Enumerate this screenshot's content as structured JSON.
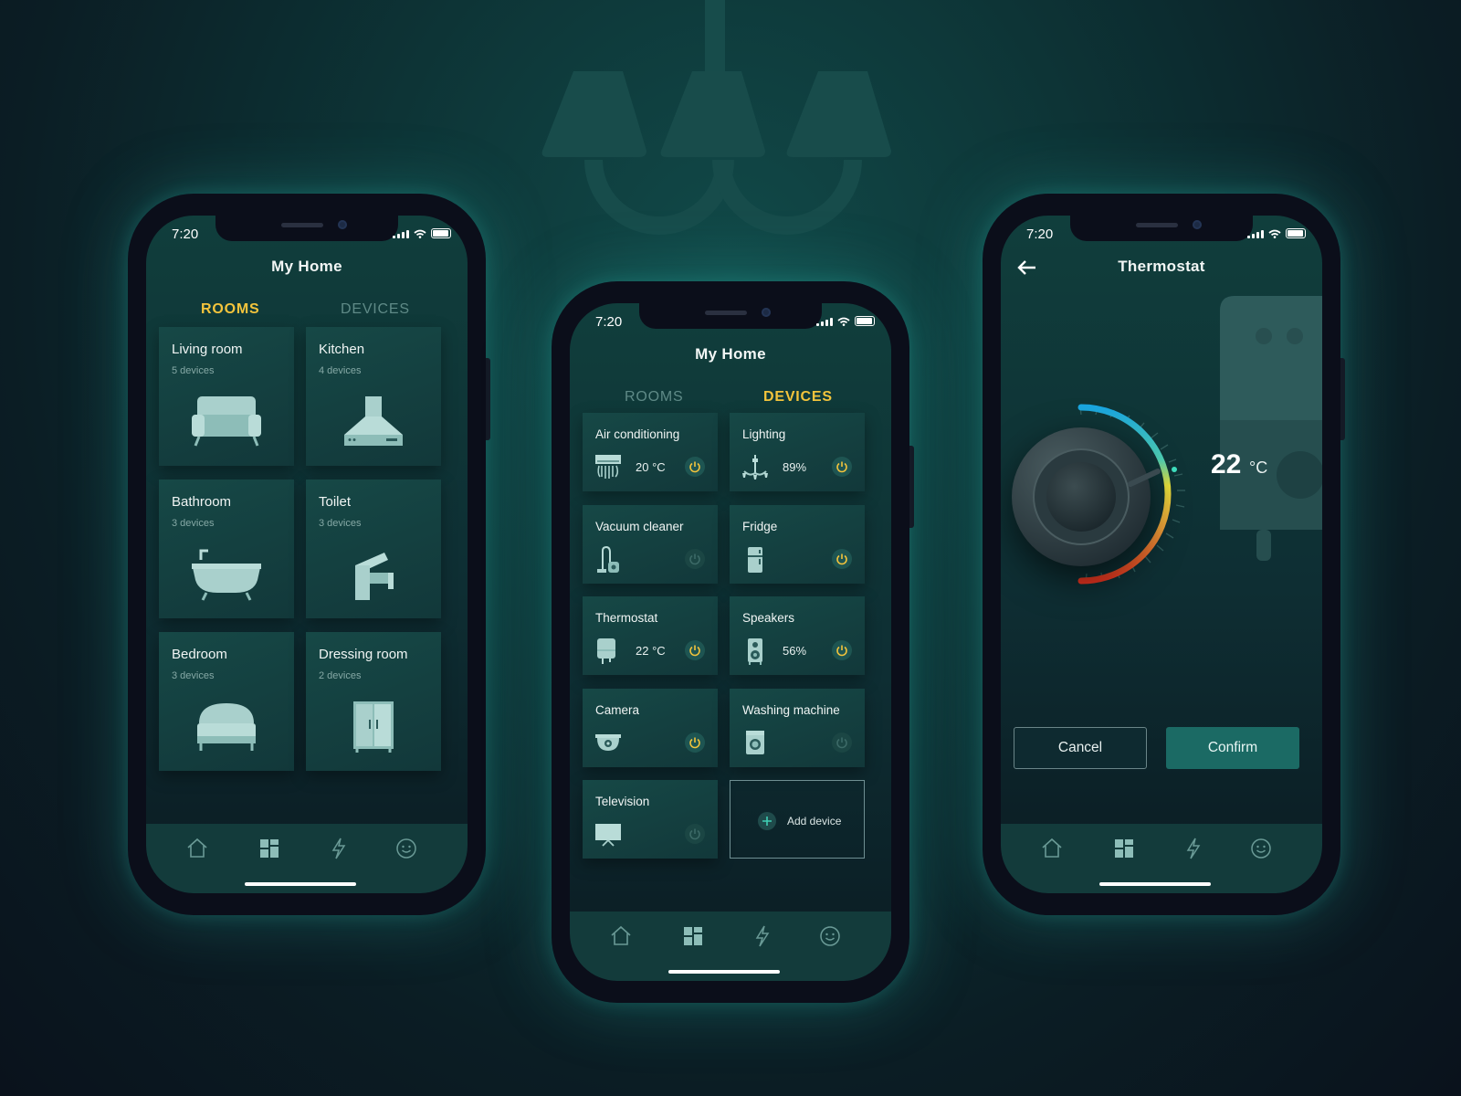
{
  "status_time": "7:20",
  "left_phone": {
    "title": "My Home",
    "tabs": [
      {
        "label": "ROOMS",
        "active": true
      },
      {
        "label": "DEVICES",
        "active": false
      }
    ],
    "rooms": [
      {
        "name": "Living room",
        "devices": "5 devices",
        "icon": "sofa-icon"
      },
      {
        "name": "Kitchen",
        "devices": "4 devices",
        "icon": "range-hood-icon"
      },
      {
        "name": "Bathroom",
        "devices": "3 devices",
        "icon": "bathtub-icon"
      },
      {
        "name": "Toilet",
        "devices": "3 devices",
        "icon": "faucet-icon"
      },
      {
        "name": "Bedroom",
        "devices": "3 devices",
        "icon": "bed-icon"
      },
      {
        "name": "Dressing room",
        "devices": "2 devices",
        "icon": "wardrobe-icon"
      }
    ]
  },
  "middle_phone": {
    "title": "My Home",
    "tabs": [
      {
        "label": "ROOMS",
        "active": false
      },
      {
        "label": "DEVICES",
        "active": true
      }
    ],
    "devices": [
      {
        "name": "Air conditioning",
        "value": "20 °C",
        "on": true,
        "icon": "air-conditioner-icon"
      },
      {
        "name": "Lighting",
        "value": "89%",
        "on": true,
        "icon": "chandelier-icon"
      },
      {
        "name": "Vacuum cleaner",
        "value": "",
        "on": false,
        "icon": "vacuum-cleaner-icon"
      },
      {
        "name": "Fridge",
        "value": "",
        "on": true,
        "icon": "fridge-icon"
      },
      {
        "name": "Thermostat",
        "value": "22 °C",
        "on": true,
        "icon": "water-heater-icon"
      },
      {
        "name": "Speakers",
        "value": "56%",
        "on": true,
        "icon": "speaker-icon"
      },
      {
        "name": "Camera",
        "value": "",
        "on": true,
        "icon": "camera-icon"
      },
      {
        "name": "Washing machine",
        "value": "",
        "on": false,
        "icon": "washing-machine-icon"
      },
      {
        "name": "Television",
        "value": "",
        "on": false,
        "icon": "television-icon"
      }
    ],
    "add_device_label": "Add device"
  },
  "right_phone": {
    "title": "Thermostat",
    "temperature": "22",
    "unit": "°C",
    "cancel_label": "Cancel",
    "confirm_label": "Confirm"
  },
  "nav_icons": [
    "home-icon",
    "dashboard-icon",
    "lightning-icon",
    "smiley-icon"
  ],
  "colors": {
    "accent": "#f3c43c",
    "confirm": "#1b6a64",
    "background": "#0d3436"
  }
}
